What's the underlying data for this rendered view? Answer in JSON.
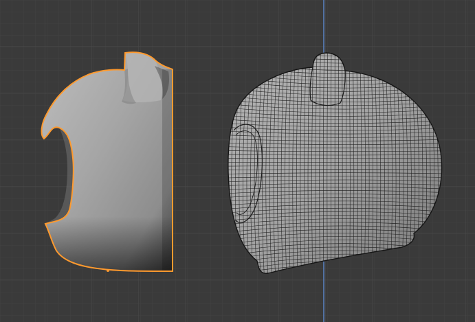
{
  "viewport": {
    "background_color": "#3a3a3a",
    "grid_minor_color": "#424242",
    "grid_major_color": "#4a4a4a",
    "axis_y_color": "#5a83c4",
    "selection_outline_color": "#ff9a2e",
    "mesh_shaded_color": "#a9a9a9",
    "wireframe_color": "#1c1c1c"
  },
  "objects": [
    {
      "name": "mesh-solid-selected",
      "shading": "solid",
      "selected": true
    },
    {
      "name": "mesh-wireframe-subdivided",
      "shading": "wireframe-overlay",
      "selected": false
    }
  ]
}
